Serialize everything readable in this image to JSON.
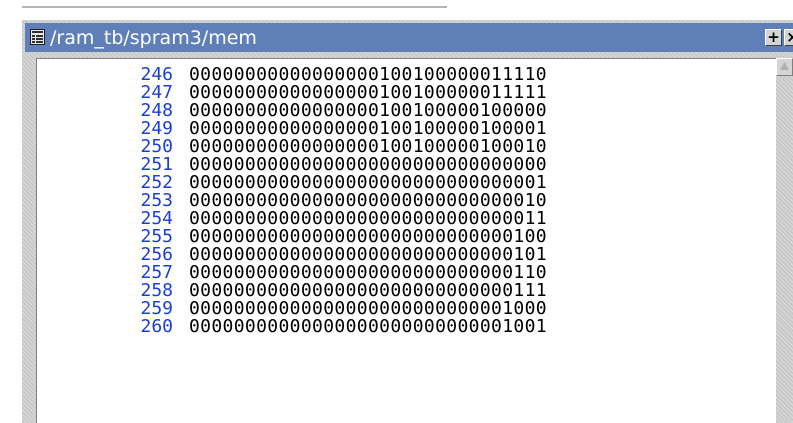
{
  "window": {
    "title": "/ram_tb/spram3/mem",
    "title_icon": "memory-window-icon",
    "add_button_icon": "plus-icon",
    "close_button_icon": "close-icon",
    "add_button_label": "+",
    "close_button_label": "×"
  },
  "colors": {
    "titlebar": "#5f7fb8",
    "address_text": "#1a3fcf",
    "value_text": "#000000",
    "frame": "#c8c8c8"
  },
  "memory": {
    "rows": [
      {
        "address": "246",
        "value": "00000000000000000100100000011110"
      },
      {
        "address": "247",
        "value": "00000000000000000100100000011111"
      },
      {
        "address": "248",
        "value": "00000000000000000100100000100000"
      },
      {
        "address": "249",
        "value": "00000000000000000100100000100001"
      },
      {
        "address": "250",
        "value": "00000000000000000100100000100010"
      },
      {
        "address": "251",
        "value": "00000000000000000000000000000000"
      },
      {
        "address": "252",
        "value": "00000000000000000000000000000001"
      },
      {
        "address": "253",
        "value": "00000000000000000000000000000010"
      },
      {
        "address": "254",
        "value": "00000000000000000000000000000011"
      },
      {
        "address": "255",
        "value": "00000000000000000000000000000100"
      },
      {
        "address": "256",
        "value": "00000000000000000000000000000101"
      },
      {
        "address": "257",
        "value": "00000000000000000000000000000110"
      },
      {
        "address": "258",
        "value": "00000000000000000000000000000111"
      },
      {
        "address": "259",
        "value": "00000000000000000000000000001000"
      },
      {
        "address": "260",
        "value": "00000000000000000000000000001001"
      }
    ]
  }
}
